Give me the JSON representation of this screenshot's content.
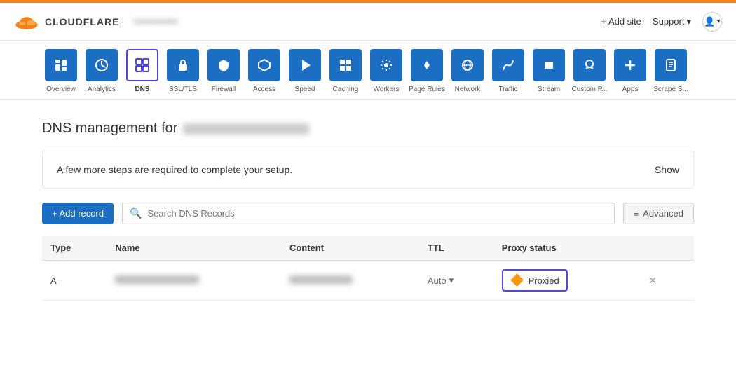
{
  "header": {
    "logo_text": "CLOUDFLARE",
    "site_name": "••••••••••••••",
    "add_site_label": "+ Add site",
    "support_label": "Support",
    "account_icon": "👤"
  },
  "nav": {
    "items": [
      {
        "id": "overview",
        "label": "Overview",
        "icon": "☰",
        "active": false
      },
      {
        "id": "analytics",
        "label": "Analytics",
        "icon": "◎",
        "active": false
      },
      {
        "id": "dns",
        "label": "DNS",
        "icon": "⊞",
        "active": true
      },
      {
        "id": "ssl-tls",
        "label": "SSL/TLS",
        "icon": "🔒",
        "active": false
      },
      {
        "id": "firewall",
        "label": "Firewall",
        "icon": "🛡",
        "active": false
      },
      {
        "id": "access",
        "label": "Access",
        "icon": "⬡",
        "active": false
      },
      {
        "id": "speed",
        "label": "Speed",
        "icon": "⚡",
        "active": false
      },
      {
        "id": "caching",
        "label": "Caching",
        "icon": "▦",
        "active": false
      },
      {
        "id": "workers",
        "label": "Workers",
        "icon": "❋",
        "active": false
      },
      {
        "id": "page-rules",
        "label": "Page Rules",
        "icon": "▼",
        "active": false
      },
      {
        "id": "network",
        "label": "Network",
        "icon": "◎",
        "active": false
      },
      {
        "id": "traffic",
        "label": "Traffic",
        "icon": "☁",
        "active": false
      },
      {
        "id": "stream",
        "label": "Stream",
        "icon": "🔧",
        "active": false
      },
      {
        "id": "custom-p",
        "label": "Custom P...",
        "icon": "🔧",
        "active": false
      },
      {
        "id": "apps",
        "label": "Apps",
        "icon": "+",
        "active": false
      },
      {
        "id": "scrape-s",
        "label": "Scrape S...",
        "icon": "📄",
        "active": false
      }
    ]
  },
  "main": {
    "page_title": "DNS management for",
    "setup_notice": "A few more steps are required to complete your setup.",
    "show_label": "Show",
    "add_record_label": "+ Add record",
    "search_placeholder": "Search DNS Records",
    "advanced_label": "Advanced",
    "table": {
      "headers": [
        "Type",
        "Name",
        "Content",
        "TTL",
        "Proxy status",
        ""
      ],
      "rows": [
        {
          "type": "A",
          "name_blurred": true,
          "content_blurred": true,
          "ttl": "Auto",
          "proxy_status": "Proxied"
        }
      ]
    }
  }
}
